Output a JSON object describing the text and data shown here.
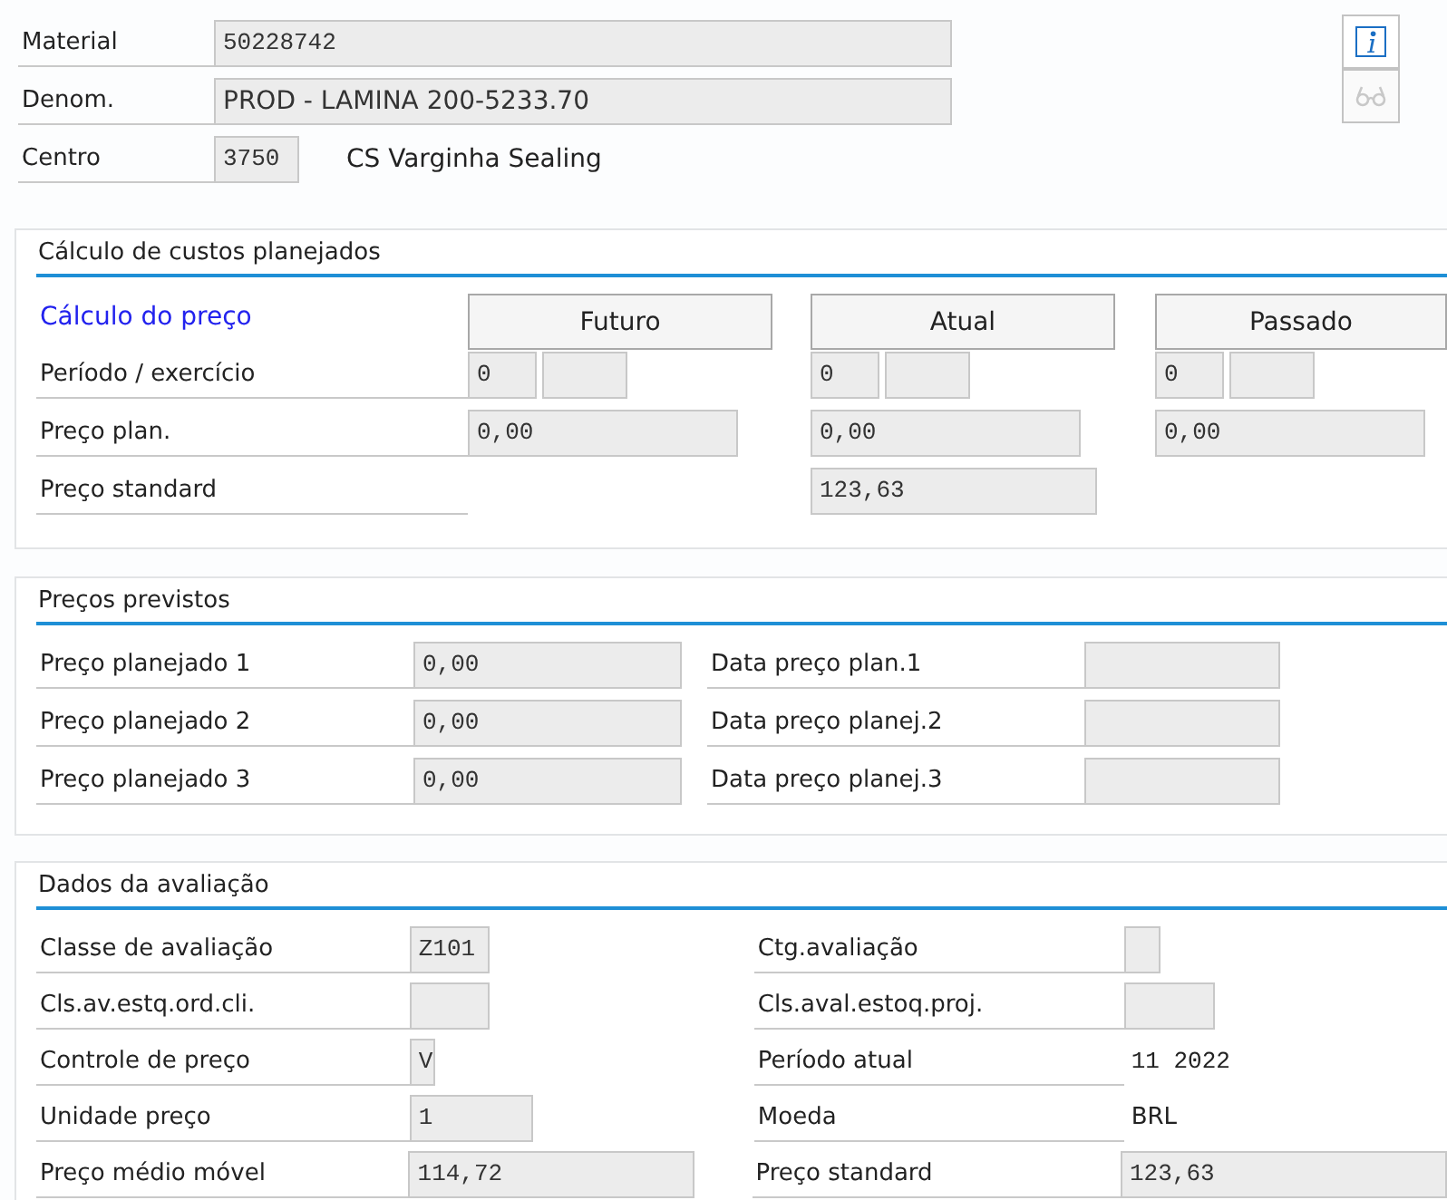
{
  "header": {
    "rows": [
      {
        "label": "Material",
        "value": "50228742",
        "kind": "code"
      },
      {
        "label": "Denom.",
        "value": "PROD - LAMINA 200-5233.70",
        "kind": "text"
      },
      {
        "label": "Centro",
        "value": "3750",
        "kind": "code",
        "description": "CS Varginha Sealing"
      }
    ],
    "tools": [
      {
        "kind": "info",
        "disabled": false
      },
      {
        "kind": "glasses",
        "disabled": true
      }
    ]
  },
  "costing": {
    "title": "Cálculo de custos planejados",
    "link": "Cálculo do preço",
    "row_labels": [
      "Período / exercício",
      "Preço plan.",
      "Preço standard"
    ],
    "columns": [
      {
        "label": "Futuro",
        "period": "0",
        "planned_price": "0,00"
      },
      {
        "label": "Atual",
        "period": "0",
        "planned_price": "0,00",
        "standard_price": "123,63"
      },
      {
        "label": "Passado",
        "period": "0",
        "planned_price": "0,00"
      }
    ]
  },
  "forecast": {
    "title": "Preços previstos",
    "rows": [
      {
        "price_label": "Preço planejado 1",
        "price": "0,00",
        "date_label": "Data preço plan.1"
      },
      {
        "price_label": "Preço planejado 2",
        "price": "0,00",
        "date_label": "Data preço planej.2"
      },
      {
        "price_label": "Preço planejado 3",
        "price": "0,00",
        "date_label": "Data preço planej.3"
      }
    ]
  },
  "valuation": {
    "title": "Dados da avaliação",
    "rows": [
      {
        "left": {
          "label": "Classe de avaliação",
          "kind": "field",
          "value": "Z101"
        },
        "right": {
          "label": "Ctg.avaliação",
          "kind": "field"
        }
      },
      {
        "left": {
          "label": "Cls.av.estq.ord.cli.",
          "kind": "field"
        },
        "right": {
          "label": "Cls.aval.estoq.proj.",
          "kind": "field"
        }
      },
      {
        "left": {
          "label": "Controle de preço",
          "kind": "field",
          "value": "V"
        },
        "right": {
          "label": "Período atual",
          "kind": "output",
          "value": "11 2022"
        }
      },
      {
        "left": {
          "label": "Unidade preço",
          "kind": "field",
          "value": "1"
        },
        "right": {
          "label": "Moeda",
          "kind": "unit",
          "value": "BRL"
        }
      },
      {
        "left": {
          "label": "Preço médio móvel",
          "kind": "field",
          "value": "114,72"
        },
        "right": {
          "label": "Preço standard",
          "kind": "field",
          "value": "123,63"
        }
      }
    ]
  }
}
